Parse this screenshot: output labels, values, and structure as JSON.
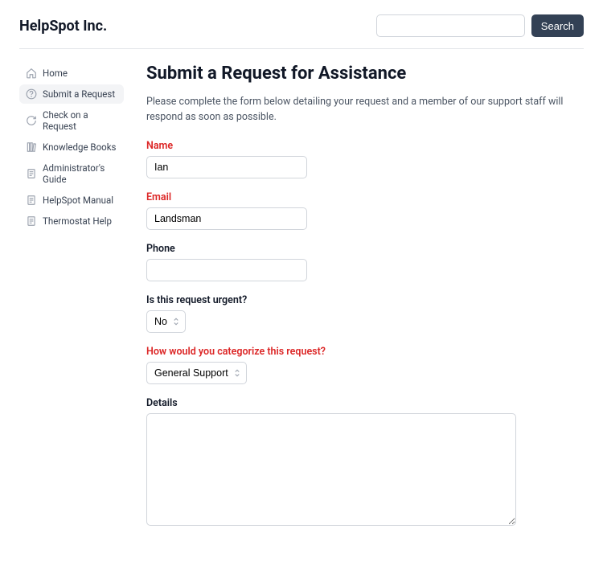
{
  "brand": "HelpSpot Inc.",
  "search": {
    "button_label": "Search",
    "value": ""
  },
  "sidebar": {
    "items": [
      {
        "label": "Home",
        "icon": "home-icon"
      },
      {
        "label": "Submit a Request",
        "icon": "question-icon"
      },
      {
        "label": "Check on a Request",
        "icon": "refresh-icon"
      },
      {
        "label": "Knowledge Books",
        "icon": "books-icon"
      },
      {
        "label": "Administrator's Guide",
        "icon": "doc-icon"
      },
      {
        "label": "HelpSpot Manual",
        "icon": "doc-icon"
      },
      {
        "label": "Thermostat Help",
        "icon": "doc-icon"
      }
    ],
    "active_index": 1
  },
  "page": {
    "title": "Submit a Request for Assistance",
    "intro": "Please complete the form below detailing your request and a member of our support staff will respond as soon as possible."
  },
  "form": {
    "name": {
      "label": "Name",
      "value": "Ian",
      "required": true
    },
    "email": {
      "label": "Email",
      "value": "Landsman",
      "required": true
    },
    "phone": {
      "label": "Phone",
      "value": "",
      "required": false
    },
    "urgent": {
      "label": "Is this request urgent?",
      "value": "No",
      "required": false
    },
    "category": {
      "label": "How would you categorize this request?",
      "value": "General Support",
      "required": true
    },
    "details": {
      "label": "Details",
      "value": "",
      "required": false
    }
  }
}
